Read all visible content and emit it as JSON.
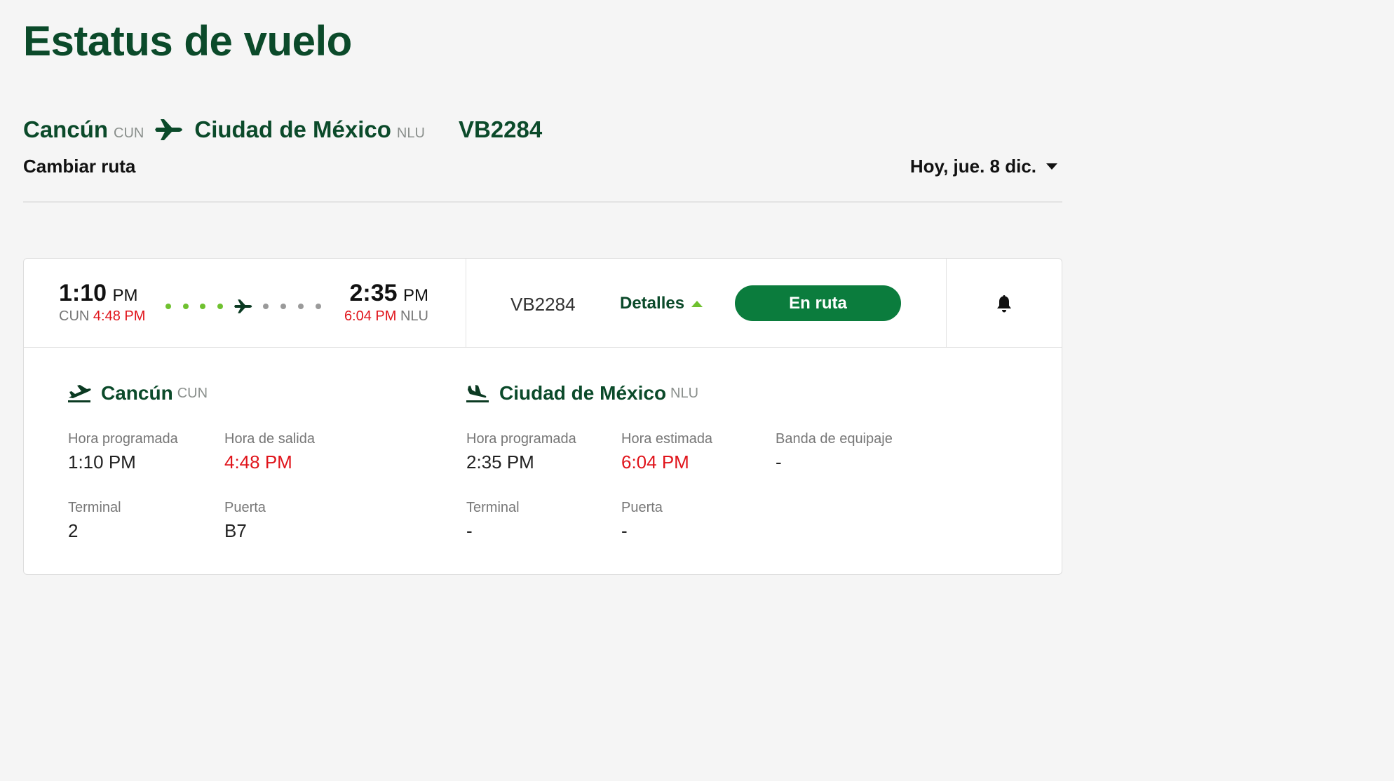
{
  "page_title": "Estatus de vuelo",
  "route": {
    "origin_city": "Cancún",
    "origin_code": "CUN",
    "destination_city": "Ciudad de México",
    "destination_code": "NLU",
    "flight_number": "VB2284",
    "change_route_label": "Cambiar ruta",
    "date_label": "Hoy, jue. 8 dic."
  },
  "summary": {
    "dep_time": "1:10",
    "dep_ampm": "PM",
    "dep_code": "CUN",
    "dep_actual": "4:48 PM",
    "arr_time": "2:35",
    "arr_ampm": "PM",
    "arr_code": "NLU",
    "arr_estimated": "6:04 PM",
    "flight_code": "VB2284",
    "details_label": "Detalles",
    "status_label": "En ruta"
  },
  "departure": {
    "city": "Cancún",
    "code": "CUN",
    "fields": [
      {
        "label": "Hora programada",
        "value": "1:10 PM"
      },
      {
        "label": "Hora de salida",
        "value": "4:48 PM"
      },
      {
        "label": "Terminal",
        "value": "2"
      },
      {
        "label": "Puerta",
        "value": "B7"
      }
    ]
  },
  "arrival": {
    "city": "Ciudad de México",
    "code": "NLU",
    "fields": [
      {
        "label": "Hora programada",
        "value": "2:35 PM"
      },
      {
        "label": "Hora estimada",
        "value": "6:04 PM"
      },
      {
        "label": "Banda de equipaje",
        "value": "-"
      },
      {
        "label": "Terminal",
        "value": "-"
      },
      {
        "label": "Puerta",
        "value": "-"
      }
    ]
  },
  "colors": {
    "brand_green": "#0b4a2a",
    "button_green": "#0b7c3d",
    "progress_green": "#6fc12f",
    "delay_red": "#e0141b"
  },
  "icons": [
    "plane-icon",
    "plane-small-icon",
    "caret-down-icon",
    "caret-up-icon",
    "bell-icon",
    "takeoff-icon",
    "landing-icon"
  ]
}
